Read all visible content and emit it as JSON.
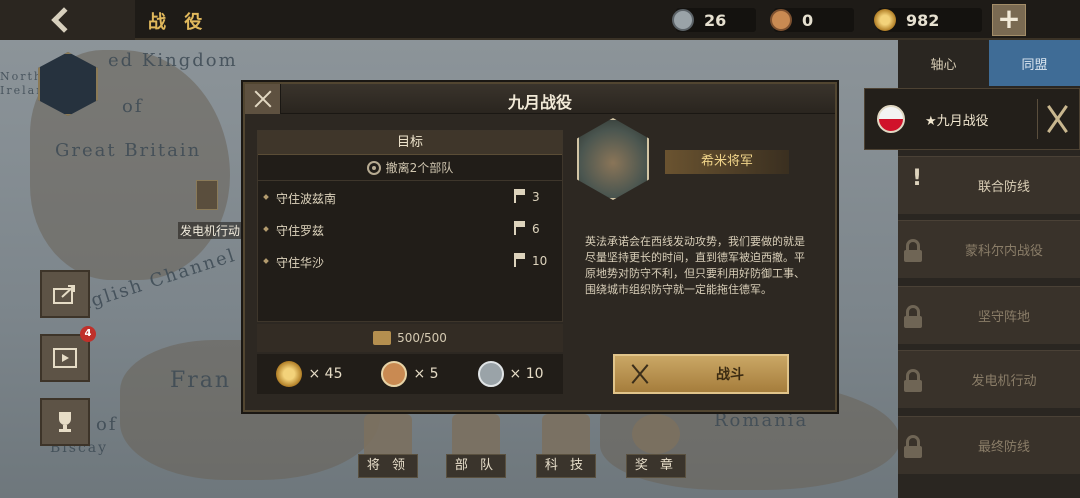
{
  "header": {
    "title": "战 役"
  },
  "resources": [
    {
      "name": "silver-medal",
      "value": "26",
      "color": "#9aa3a8"
    },
    {
      "name": "bronze-medal",
      "value": "0",
      "color": "#c98a52"
    },
    {
      "name": "gold-star-medal",
      "value": "982",
      "color": "#d9a83a"
    }
  ],
  "map": {
    "labels": [
      "ed Kingdom",
      "of",
      "Great Britain",
      "English Channel",
      "Fran",
      "of",
      "Biscay",
      "Romania",
      "North",
      "Ireland",
      "发电机行动"
    ]
  },
  "side_buttons": {
    "badge_count": "4"
  },
  "bottom_nav": [
    {
      "label": "将 领"
    },
    {
      "label": "部 队"
    },
    {
      "label": "科 技"
    },
    {
      "label": "奖 章"
    }
  ],
  "right_panel": {
    "tabs": [
      "轴心",
      "同盟"
    ],
    "selected": "★九月战役",
    "items": [
      {
        "label": "联合防线",
        "locked": false
      },
      {
        "label": "蒙科尔内战役",
        "locked": true
      },
      {
        "label": "坚守阵地",
        "locked": true
      },
      {
        "label": "发电机行动",
        "locked": true
      },
      {
        "label": "最终防线",
        "locked": true
      }
    ]
  },
  "dialog": {
    "title": "九月战役",
    "objective_header": "目标",
    "objective_sub": "撤离2个部队",
    "objectives": [
      {
        "name": "守住波兹南",
        "count": "3"
      },
      {
        "name": "守住罗兹",
        "count": "6"
      },
      {
        "name": "守住华沙",
        "count": "10"
      }
    ],
    "reward_total": "500/500",
    "rewards": [
      {
        "icon": "gold-star-medal",
        "amount": "× 45",
        "color": "#d9a83a"
      },
      {
        "icon": "bronze-medal",
        "amount": "× 5",
        "color": "#c98a52"
      },
      {
        "icon": "silver-medal",
        "amount": "× 10",
        "color": "#9aa3a8"
      }
    ],
    "general_name": "希米将军",
    "description": "英法承诺会在西线发动攻势，我们要做的就是尽量坚持更长的时间，直到德军被迫西撤。平原地势对防守不利，但只要利用好防御工事、围绕城市组织防守就一定能拖住德军。",
    "fight_label": "战斗"
  }
}
